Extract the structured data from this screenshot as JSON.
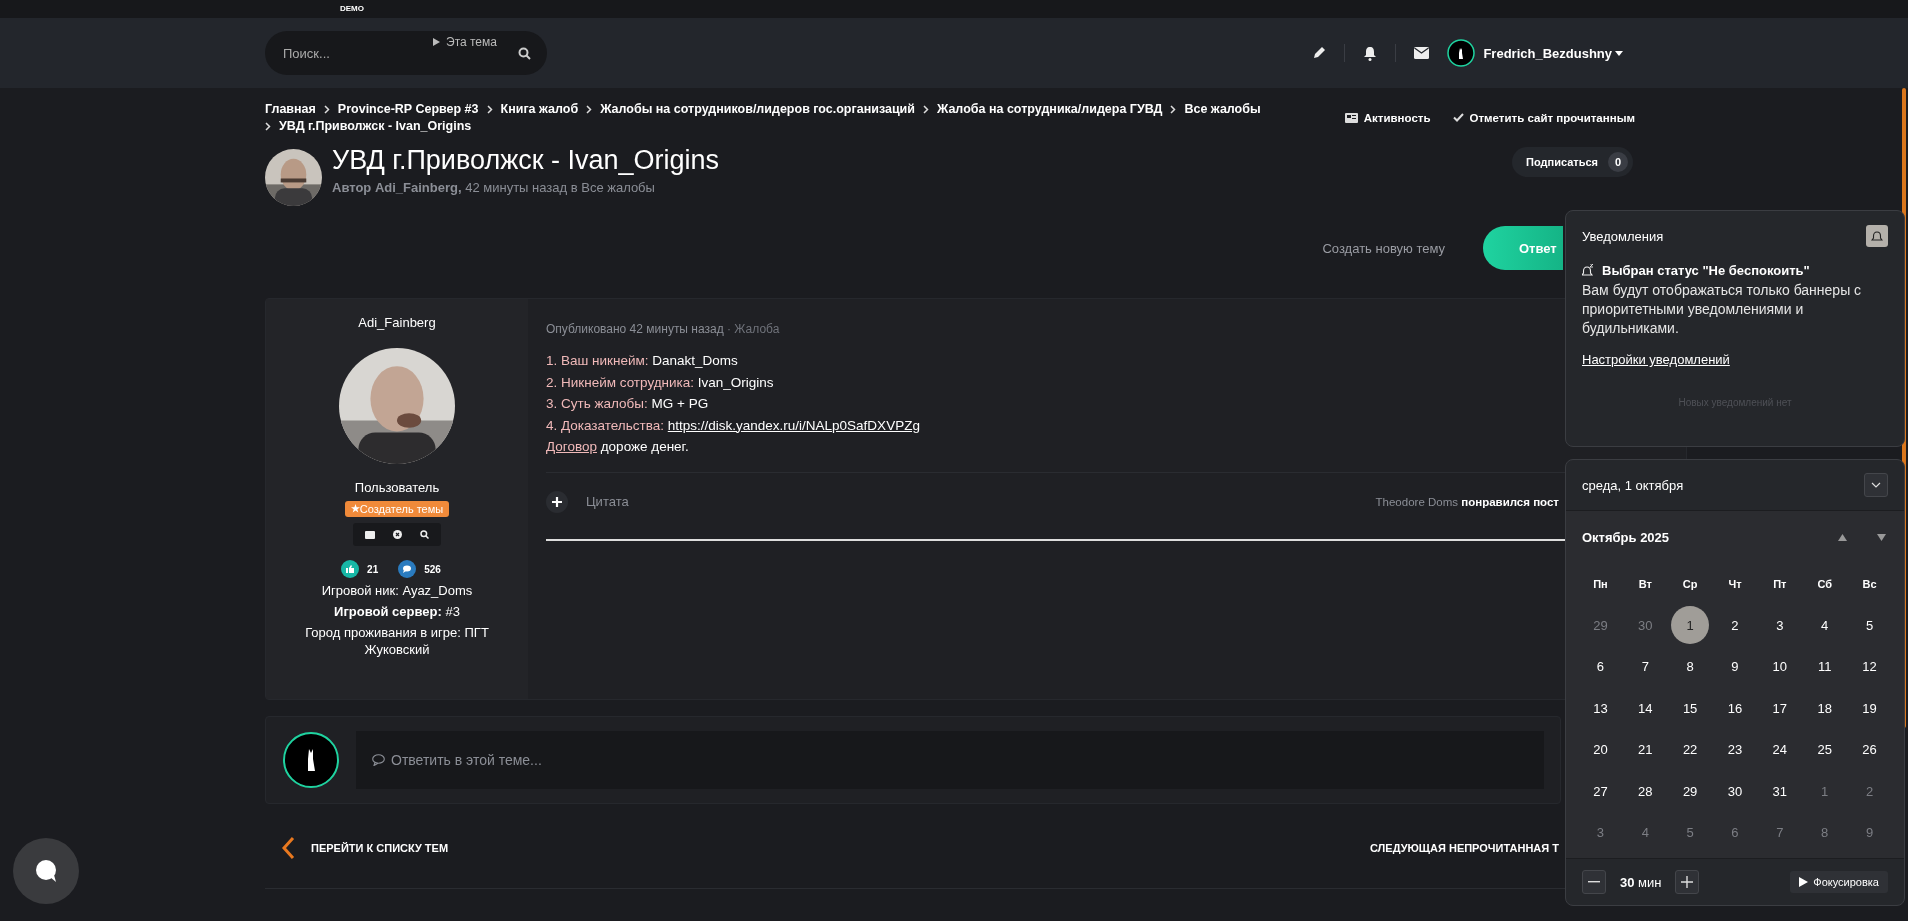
{
  "topbar": {
    "logo_tag": "DEMO"
  },
  "nav": {
    "search": {
      "placeholder": "Поиск...",
      "scope": "Эта тема"
    },
    "user": {
      "name": "Fredrich_Bezdushny"
    }
  },
  "breadcrumbs": [
    "Главная",
    "Province-RP Сервер #3",
    "Книга жалоб",
    "Жалобы на сотрудников/лидеров гос.организаций",
    "Жалоба на сотрудника/лидера ГУВД",
    "Все жалобы"
  ],
  "breadcrumb_current": "УВД г.Приволжск - Ivan_Origins",
  "page_actions": [
    "Активность",
    "Отметить сайт прочитанным"
  ],
  "topic": {
    "title": "УВД г.Приволжск - Ivan_Origins",
    "byline": "**Автор Adi_Fainberg,** 42 минуты назад в Все жалобы",
    "subscribe": {
      "label": "Подписаться",
      "count": "0"
    }
  },
  "topic_buttons": {
    "create": "Создать новую тему",
    "reply": "Ответ"
  },
  "post": {
    "author": {
      "name": "Adi_Fainberg",
      "role": "Пользователь",
      "badge": "Создатель темы",
      "likes": "21",
      "posts": "526",
      "info": [
        "Игровой ник: Ayaz_Doms",
        "**Игровой сервер:** #3",
        "Город проживания в игре: ПГТ Жуковский"
      ]
    },
    "meta": {
      "published": "Опубликовано 42 минуты назад",
      "category": "· Жалоба"
    },
    "lines": [
      {
        "kind": "text",
        "label": "1. Ваш никнейм:",
        "value": "Danakt_Doms"
      },
      {
        "kind": "text",
        "label": "2. Никнейм сотрудника:",
        "value": "Ivan_Origins"
      },
      {
        "kind": "text",
        "label": "3. Суть жалобы:",
        "value": "MG + PG"
      },
      {
        "kind": "link",
        "label": "4. Доказательства:",
        "value": "https://disk.yandex.ru/i/NALp0SafDXVPZg"
      }
    ],
    "closing": {
      "link": "Договор",
      "text": " дороже денег."
    },
    "quote": "Цитата",
    "liked_by": "Theodore Doms",
    "liked_text": "понравился пост"
  },
  "reply_box": {
    "placeholder": "Ответить в этой теме..."
  },
  "bottom_nav": {
    "back": "ПЕРЕЙТИ К СПИСКУ ТЕМ",
    "next": "СЛЕДУЮЩАЯ НЕПРОЧИТАННАЯ Т"
  },
  "notifications": {
    "title": "Уведомления",
    "status_title": "Выбран статус \"Не беспокоить\"",
    "status_text": "Вам будут отображаться только баннеры с приоритетными уведомлениями и будильниками.",
    "settings_link": "Настройки уведомлений",
    "empty": "Новых уведомлений нет"
  },
  "calendar": {
    "date": "среда, 1 октября",
    "month": "Октябрь 2025",
    "weekdays": [
      "Пн",
      "Вт",
      "Ср",
      "Чт",
      "Пт",
      "Сб",
      "Вс"
    ],
    "days": [
      {
        "d": "29",
        "muted": true,
        "selected": false
      },
      {
        "d": "30",
        "muted": true,
        "selected": false
      },
      {
        "d": "1",
        "muted": false,
        "selected": true
      },
      {
        "d": "2",
        "muted": false,
        "selected": false
      },
      {
        "d": "3",
        "muted": false,
        "selected": false
      },
      {
        "d": "4",
        "muted": false,
        "selected": false
      },
      {
        "d": "5",
        "muted": false,
        "selected": false
      },
      {
        "d": "6",
        "muted": false,
        "selected": false
      },
      {
        "d": "7",
        "muted": false,
        "selected": false
      },
      {
        "d": "8",
        "muted": false,
        "selected": false
      },
      {
        "d": "9",
        "muted": false,
        "selected": false
      },
      {
        "d": "10",
        "muted": false,
        "selected": false
      },
      {
        "d": "11",
        "muted": false,
        "selected": false
      },
      {
        "d": "12",
        "muted": false,
        "selected": false
      },
      {
        "d": "13",
        "muted": false,
        "selected": false
      },
      {
        "d": "14",
        "muted": false,
        "selected": false
      },
      {
        "d": "15",
        "muted": false,
        "selected": false
      },
      {
        "d": "16",
        "muted": false,
        "selected": false
      },
      {
        "d": "17",
        "muted": false,
        "selected": false
      },
      {
        "d": "18",
        "muted": false,
        "selected": false
      },
      {
        "d": "19",
        "muted": false,
        "selected": false
      },
      {
        "d": "20",
        "muted": false,
        "selected": false
      },
      {
        "d": "21",
        "muted": false,
        "selected": false
      },
      {
        "d": "22",
        "muted": false,
        "selected": false
      },
      {
        "d": "23",
        "muted": false,
        "selected": false
      },
      {
        "d": "24",
        "muted": false,
        "selected": false
      },
      {
        "d": "25",
        "muted": false,
        "selected": false
      },
      {
        "d": "26",
        "muted": false,
        "selected": false
      },
      {
        "d": "27",
        "muted": false,
        "selected": false
      },
      {
        "d": "28",
        "muted": false,
        "selected": false
      },
      {
        "d": "29",
        "muted": false,
        "selected": false
      },
      {
        "d": "30",
        "muted": false,
        "selected": false
      },
      {
        "d": "31",
        "muted": false,
        "selected": false
      },
      {
        "d": "1",
        "muted": true,
        "selected": false
      },
      {
        "d": "2",
        "muted": true,
        "selected": false
      },
      {
        "d": "3",
        "muted": true,
        "selected": false
      },
      {
        "d": "4",
        "muted": true,
        "selected": false
      },
      {
        "d": "5",
        "muted": true,
        "selected": false
      },
      {
        "d": "6",
        "muted": true,
        "selected": false
      },
      {
        "d": "7",
        "muted": true,
        "selected": false
      },
      {
        "d": "8",
        "muted": true,
        "selected": false
      },
      {
        "d": "9",
        "muted": true,
        "selected": false
      }
    ],
    "focus": {
      "minutes": "30",
      "unit": "мин",
      "button": "Фокусировка"
    }
  }
}
